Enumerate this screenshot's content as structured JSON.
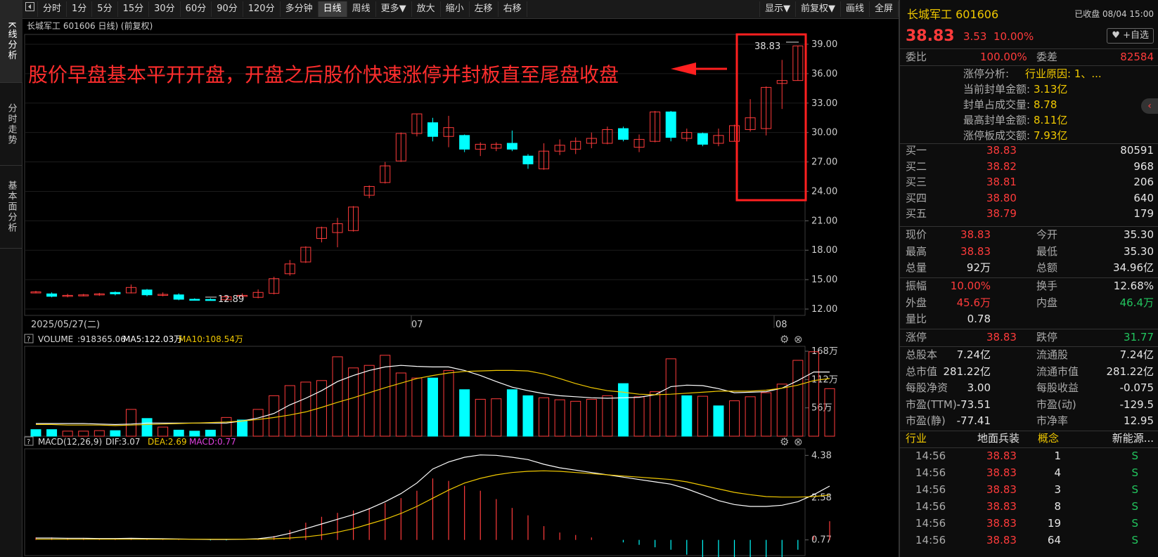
{
  "toolbar": {
    "items": [
      "分时",
      "1分",
      "5分",
      "15分",
      "30分",
      "60分",
      "90分",
      "120分",
      "多分钟",
      "日线",
      "周线",
      "更多▼",
      "放大",
      "缩小",
      "左移",
      "右移"
    ],
    "right_items": [
      "显示▼",
      "前复权▼",
      "画线",
      "全屏"
    ],
    "active": "日线"
  },
  "left_tabs": [
    "K线分析",
    "分时走势",
    "基本面分析"
  ],
  "chart_header": {
    "title": "长城军工 601606 日线) (前复权)"
  },
  "annotation": "股价早盘基本平开开盘，开盘之后股价快速涨停并封板直至尾盘收盘",
  "price_labels": {
    "high": "38.83",
    "low": "12.89"
  },
  "date_labels": [
    "2025/05/27(二)",
    "07",
    "08"
  ],
  "volume_legend": {
    "name": "VOLUME",
    "value": ":918365.06",
    "ma5": "MA5:122.03万",
    "ma10": "MA10:108.54万"
  },
  "macd_legend": {
    "name": "MACD(12,26,9)",
    "dif": "DIF:3.07",
    "dea": "DEA:2.69",
    "macd": "MACD:0.77"
  },
  "chart_data": [
    {
      "type": "candlestick",
      "title": "长城军工 601606 日线) (前复权)",
      "ylim": [
        11.5,
        40.0
      ],
      "yticks": [
        "39.00",
        "36.00",
        "33.00",
        "30.00",
        "27.00",
        "24.00",
        "21.00",
        "18.00",
        "15.00",
        "12.00"
      ],
      "candles": [
        {
          "o": 13.7,
          "c": 13.75,
          "h": 13.85,
          "l": 13.6
        },
        {
          "o": 13.55,
          "c": 13.3,
          "h": 13.7,
          "l": 13.2
        },
        {
          "o": 13.3,
          "c": 13.4,
          "h": 13.55,
          "l": 13.2
        },
        {
          "o": 13.4,
          "c": 13.45,
          "h": 13.55,
          "l": 13.3
        },
        {
          "o": 13.5,
          "c": 13.55,
          "h": 13.65,
          "l": 13.35
        },
        {
          "o": 13.7,
          "c": 13.55,
          "h": 13.8,
          "l": 13.4
        },
        {
          "o": 13.65,
          "c": 14.2,
          "h": 14.5,
          "l": 13.6
        },
        {
          "o": 13.95,
          "c": 13.45,
          "h": 14.05,
          "l": 13.3
        },
        {
          "o": 13.4,
          "c": 13.5,
          "h": 13.7,
          "l": 13.3
        },
        {
          "o": 13.45,
          "c": 13.0,
          "h": 13.6,
          "l": 12.9
        },
        {
          "o": 13.0,
          "c": 12.95,
          "h": 13.1,
          "l": 12.9
        },
        {
          "o": 12.98,
          "c": 12.9,
          "h": 13.1,
          "l": 12.89
        },
        {
          "o": 12.95,
          "c": 13.25,
          "h": 13.4,
          "l": 12.9
        },
        {
          "o": 13.3,
          "c": 13.4,
          "h": 13.6,
          "l": 13.2
        },
        {
          "o": 13.2,
          "c": 13.7,
          "h": 14.0,
          "l": 13.1
        },
        {
          "o": 13.6,
          "c": 15.1,
          "h": 15.3,
          "l": 13.5
        },
        {
          "o": 15.6,
          "c": 16.6,
          "h": 17.0,
          "l": 15.4
        },
        {
          "o": 16.8,
          "c": 18.3,
          "h": 18.4,
          "l": 16.7
        },
        {
          "o": 19.2,
          "c": 20.3,
          "h": 20.4,
          "l": 18.8
        },
        {
          "o": 19.8,
          "c": 20.7,
          "h": 21.3,
          "l": 18.3
        },
        {
          "o": 20.0,
          "c": 22.4,
          "h": 22.5,
          "l": 19.9
        },
        {
          "o": 23.6,
          "c": 24.5,
          "h": 24.6,
          "l": 23.3
        },
        {
          "o": 24.9,
          "c": 26.6,
          "h": 27.0,
          "l": 24.8
        },
        {
          "o": 27.1,
          "c": 29.9,
          "h": 30.0,
          "l": 27.0
        },
        {
          "o": 29.9,
          "c": 31.9,
          "h": 31.9,
          "l": 29.6
        },
        {
          "o": 31.0,
          "c": 29.6,
          "h": 31.5,
          "l": 29.1
        },
        {
          "o": 29.6,
          "c": 30.5,
          "h": 31.7,
          "l": 28.5
        },
        {
          "o": 29.7,
          "c": 28.3,
          "h": 29.8,
          "l": 28.0
        },
        {
          "o": 28.3,
          "c": 28.8,
          "h": 29.0,
          "l": 27.6
        },
        {
          "o": 28.4,
          "c": 28.8,
          "h": 29.0,
          "l": 28.1
        },
        {
          "o": 28.9,
          "c": 28.3,
          "h": 30.2,
          "l": 28.1
        },
        {
          "o": 27.6,
          "c": 26.8,
          "h": 27.8,
          "l": 26.3
        },
        {
          "o": 26.3,
          "c": 28.1,
          "h": 28.9,
          "l": 26.2
        },
        {
          "o": 28.1,
          "c": 28.7,
          "h": 29.3,
          "l": 27.7
        },
        {
          "o": 28.3,
          "c": 29.1,
          "h": 29.5,
          "l": 27.8
        },
        {
          "o": 28.9,
          "c": 29.4,
          "h": 30.0,
          "l": 28.4
        },
        {
          "o": 28.9,
          "c": 30.3,
          "h": 30.6,
          "l": 28.8
        },
        {
          "o": 30.4,
          "c": 29.3,
          "h": 30.6,
          "l": 29.1
        },
        {
          "o": 28.5,
          "c": 29.3,
          "h": 29.8,
          "l": 28.0
        },
        {
          "o": 29.1,
          "c": 32.1,
          "h": 32.2,
          "l": 29.0
        },
        {
          "o": 32.1,
          "c": 29.5,
          "h": 32.2,
          "l": 29.1
        },
        {
          "o": 29.4,
          "c": 30.0,
          "h": 30.4,
          "l": 29.1
        },
        {
          "o": 29.9,
          "c": 28.8,
          "h": 30.0,
          "l": 28.6
        },
        {
          "o": 28.9,
          "c": 29.7,
          "h": 30.4,
          "l": 28.6
        },
        {
          "o": 29.1,
          "c": 30.7,
          "h": 30.8,
          "l": 29.1
        },
        {
          "o": 30.3,
          "c": 31.5,
          "h": 33.4,
          "l": 30.1
        },
        {
          "o": 30.4,
          "c": 34.6,
          "h": 34.7,
          "l": 29.7
        },
        {
          "o": 35.0,
          "c": 35.3,
          "h": 37.4,
          "l": 32.4
        },
        {
          "o": 35.3,
          "c": 38.83,
          "h": 38.83,
          "l": 35.3
        }
      ]
    },
    {
      "type": "bar",
      "title": "VOLUME",
      "ylim": [
        0,
        175
      ],
      "yticks": [
        "168万",
        "112万",
        "56万"
      ],
      "values": [
        13,
        13,
        10,
        10,
        11,
        11,
        53,
        35,
        18,
        12,
        10,
        12,
        37,
        32,
        53,
        80,
        100,
        107,
        110,
        157,
        135,
        140,
        160,
        125,
        115,
        115,
        130,
        92,
        73,
        74,
        92,
        80,
        76,
        72,
        69,
        73,
        80,
        104,
        78,
        88,
        153,
        80,
        79,
        60,
        70,
        78,
        86,
        103,
        150,
        167,
        94
      ],
      "up": [
        false,
        false,
        true,
        true,
        true,
        false,
        true,
        false,
        true,
        false,
        false,
        false,
        true,
        false,
        true,
        true,
        true,
        true,
        true,
        true,
        true,
        true,
        true,
        true,
        true,
        false,
        true,
        false,
        true,
        true,
        false,
        false,
        true,
        true,
        true,
        true,
        true,
        false,
        true,
        true,
        true,
        false,
        true,
        false,
        true,
        true,
        true,
        true,
        true,
        true,
        true
      ],
      "ma5": [
        25,
        25,
        25,
        25,
        24,
        23,
        24,
        26,
        26,
        26,
        26,
        26,
        26,
        30,
        36,
        45,
        62,
        75,
        90,
        108,
        120,
        130,
        137,
        140,
        138,
        137,
        137,
        130,
        120,
        108,
        97,
        90,
        84,
        80,
        78,
        76,
        75,
        76,
        77,
        82,
        98,
        101,
        100,
        94,
        86,
        87,
        88,
        95,
        110,
        127,
        127
      ],
      "ma10": [
        23,
        23,
        22,
        22,
        22,
        21,
        22,
        23,
        24,
        25,
        26,
        27,
        28,
        30,
        33,
        37,
        42,
        48,
        57,
        67,
        76,
        86,
        96,
        105,
        114,
        120,
        125,
        128,
        129,
        130,
        130,
        129,
        123,
        114,
        104,
        96,
        90,
        87,
        83,
        82,
        83,
        85,
        87,
        89,
        89,
        89,
        91,
        95,
        101,
        110,
        114
      ]
    },
    {
      "type": "line",
      "title": "MACD(12,26,9)",
      "ylim": [
        0.1,
        4.6
      ],
      "yticks": [
        "4.38",
        "2.58",
        "0.77"
      ],
      "dif": [
        0.85,
        0.85,
        0.84,
        0.84,
        0.83,
        0.83,
        0.84,
        0.83,
        0.82,
        0.81,
        0.8,
        0.79,
        0.79,
        0.8,
        0.82,
        0.9,
        1.05,
        1.25,
        1.45,
        1.65,
        1.85,
        2.1,
        2.4,
        2.75,
        3.2,
        3.8,
        4.1,
        4.3,
        4.4,
        4.38,
        4.3,
        4.2,
        4.0,
        3.85,
        3.75,
        3.65,
        3.55,
        3.45,
        3.35,
        3.25,
        3.15,
        2.95,
        2.7,
        2.45,
        2.28,
        2.2,
        2.2,
        2.25,
        2.4,
        2.7,
        3.07
      ],
      "dea": [
        0.8,
        0.8,
        0.8,
        0.8,
        0.8,
        0.8,
        0.8,
        0.8,
        0.8,
        0.8,
        0.8,
        0.8,
        0.8,
        0.8,
        0.8,
        0.82,
        0.85,
        0.9,
        0.98,
        1.1,
        1.25,
        1.45,
        1.65,
        1.9,
        2.2,
        2.55,
        2.9,
        3.2,
        3.4,
        3.55,
        3.65,
        3.7,
        3.72,
        3.7,
        3.65,
        3.6,
        3.55,
        3.5,
        3.45,
        3.4,
        3.35,
        3.25,
        3.1,
        2.95,
        2.8,
        2.7,
        2.62,
        2.6,
        2.6,
        2.62,
        2.69
      ],
      "macd": [
        0.05,
        0.05,
        0.04,
        0.04,
        0.03,
        0.03,
        0.04,
        0.03,
        0.02,
        0.01,
        0.0,
        -0.01,
        -0.01,
        0.0,
        0.02,
        0.08,
        0.2,
        0.35,
        0.47,
        0.55,
        0.6,
        0.65,
        0.75,
        0.85,
        1.0,
        1.25,
        1.2,
        1.1,
        1.0,
        0.83,
        0.65,
        0.5,
        0.28,
        0.15,
        0.1,
        0.05,
        0.0,
        -0.05,
        -0.1,
        -0.15,
        -0.2,
        -0.3,
        -0.4,
        -0.5,
        -0.52,
        -0.5,
        -0.42,
        -0.35,
        -0.2,
        0.08,
        0.38
      ]
    }
  ],
  "quote": {
    "name": "长城军工 601606",
    "status": "已收盘 08/04 15:00",
    "price": "38.83",
    "change": "3.53",
    "pct": "10.00%",
    "fav_label": "+自选",
    "weibi_label": "委比",
    "weibi": "100.00%",
    "weicha_label": "委差",
    "weicha": "82584",
    "limit_info": [
      {
        "label": "涨停分析:",
        "value": "行业原因: 1、..."
      },
      {
        "label": "当前封单金额:",
        "value": "3.13亿"
      },
      {
        "label": "封单占成交量:",
        "value": "8.78"
      },
      {
        "label": "最高封单金额:",
        "value": "8.11亿"
      },
      {
        "label": "涨停板成交额:",
        "value": "7.93亿"
      }
    ],
    "bids": [
      {
        "label": "买一",
        "price": "38.83",
        "vol": "80591"
      },
      {
        "label": "买二",
        "price": "38.82",
        "vol": "968"
      },
      {
        "label": "买三",
        "price": "38.81",
        "vol": "206"
      },
      {
        "label": "买四",
        "price": "38.80",
        "vol": "640"
      },
      {
        "label": "买五",
        "price": "38.79",
        "vol": "179"
      }
    ],
    "stats1": [
      {
        "l1": "现价",
        "v1": "38.83",
        "c1": "red",
        "l2": "今开",
        "v2": "35.30",
        "c2": "white"
      },
      {
        "l1": "最高",
        "v1": "38.83",
        "c1": "red",
        "l2": "最低",
        "v2": "35.30",
        "c2": "white"
      },
      {
        "l1": "总量",
        "v1": "92万",
        "c1": "white",
        "l2": "总额",
        "v2": "34.96亿",
        "c2": "white"
      }
    ],
    "stats2": [
      {
        "l1": "振幅",
        "v1": "10.00%",
        "c1": "red",
        "l2": "换手",
        "v2": "12.68%",
        "c2": "white"
      },
      {
        "l1": "外盘",
        "v1": "45.6万",
        "c1": "red",
        "l2": "内盘",
        "v2": "46.4万",
        "c2": "green"
      },
      {
        "l1": "量比",
        "v1": "0.78",
        "c1": "white",
        "l2": "",
        "v2": "",
        "c2": "white"
      }
    ],
    "limits": {
      "l1": "涨停",
      "v1": "38.83",
      "l2": "跌停",
      "v2": "31.77"
    },
    "fundamentals": [
      {
        "l1": "总股本",
        "v1": "7.24亿",
        "l2": "流通股",
        "v2": "7.24亿"
      },
      {
        "l1": "总市值",
        "v1": "281.22亿",
        "l2": "流通市值",
        "v2": "281.22亿"
      },
      {
        "l1": "每股净资",
        "v1": "3.00",
        "l2": "每股收益",
        "v2": "-0.075"
      },
      {
        "l1": "市盈(TTM)",
        "v1": "-73.51",
        "l2": "市盈(动)",
        "v2": "-129.5"
      },
      {
        "l1": "市盈(静)",
        "v1": "-77.41",
        "l2": "市净率",
        "v2": "12.95"
      }
    ],
    "industry": {
      "l1": "行业",
      "v1": "地面兵装",
      "l2": "概念",
      "v2": "新能源..."
    },
    "ticks": [
      {
        "time": "14:56",
        "price": "38.83",
        "vol": "1",
        "side": "S"
      },
      {
        "time": "14:56",
        "price": "38.83",
        "vol": "4",
        "side": "S"
      },
      {
        "time": "14:56",
        "price": "38.83",
        "vol": "3",
        "side": "S"
      },
      {
        "time": "14:56",
        "price": "38.83",
        "vol": "8",
        "side": "S"
      },
      {
        "time": "14:56",
        "price": "38.83",
        "vol": "19",
        "side": "S"
      },
      {
        "time": "14:56",
        "price": "38.83",
        "vol": "64",
        "side": "S"
      }
    ]
  },
  "colors": {
    "up": "#ff3b3b",
    "down": "#00ffff",
    "ma5": "#ffffff",
    "ma10": "#f0c800",
    "dif": "#ffffff",
    "dea": "#f0c800",
    "highlight": "#ff2020"
  }
}
